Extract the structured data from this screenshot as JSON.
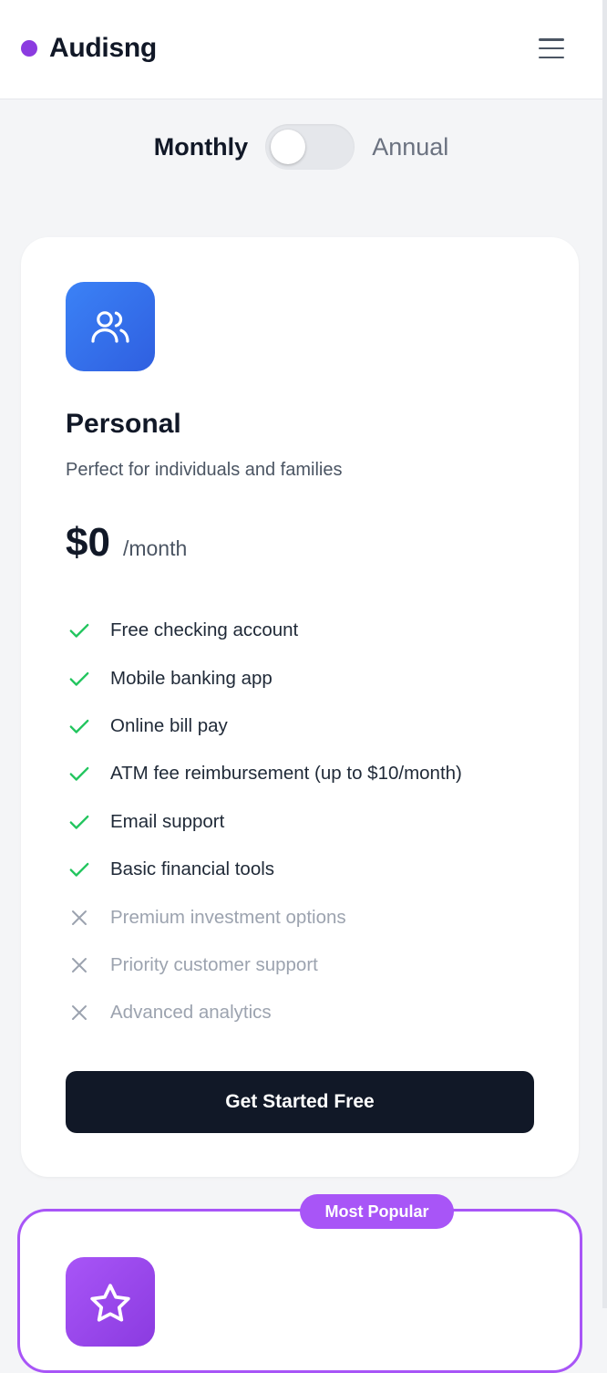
{
  "header": {
    "brand_name": "Audisng",
    "brand_color": "#8b3be0",
    "menu_icon": "hamburger-menu-icon"
  },
  "billing_toggle": {
    "monthly_label": "Monthly",
    "annual_label": "Annual",
    "selected": "Monthly"
  },
  "plans": [
    {
      "icon": "users-icon",
      "name": "Personal",
      "description": "Perfect for individuals and families",
      "price": "$0",
      "period": "/month",
      "features": [
        {
          "label": "Free checking account",
          "included": true
        },
        {
          "label": "Mobile banking app",
          "included": true
        },
        {
          "label": "Online bill pay",
          "included": true
        },
        {
          "label": "ATM fee reimbursement (up to $10/month)",
          "included": true
        },
        {
          "label": "Email support",
          "included": true
        },
        {
          "label": "Basic financial tools",
          "included": true
        },
        {
          "label": "Premium investment options",
          "included": false
        },
        {
          "label": "Priority customer support",
          "included": false
        },
        {
          "label": "Advanced analytics",
          "included": false
        }
      ],
      "cta_label": "Get Started Free"
    },
    {
      "icon": "star-icon",
      "badge": "Most Popular",
      "accent_color": "#a855f7"
    }
  ],
  "colors": {
    "check": "#22c55e",
    "cross": "#9ca3af",
    "primary_button": "#111827"
  }
}
